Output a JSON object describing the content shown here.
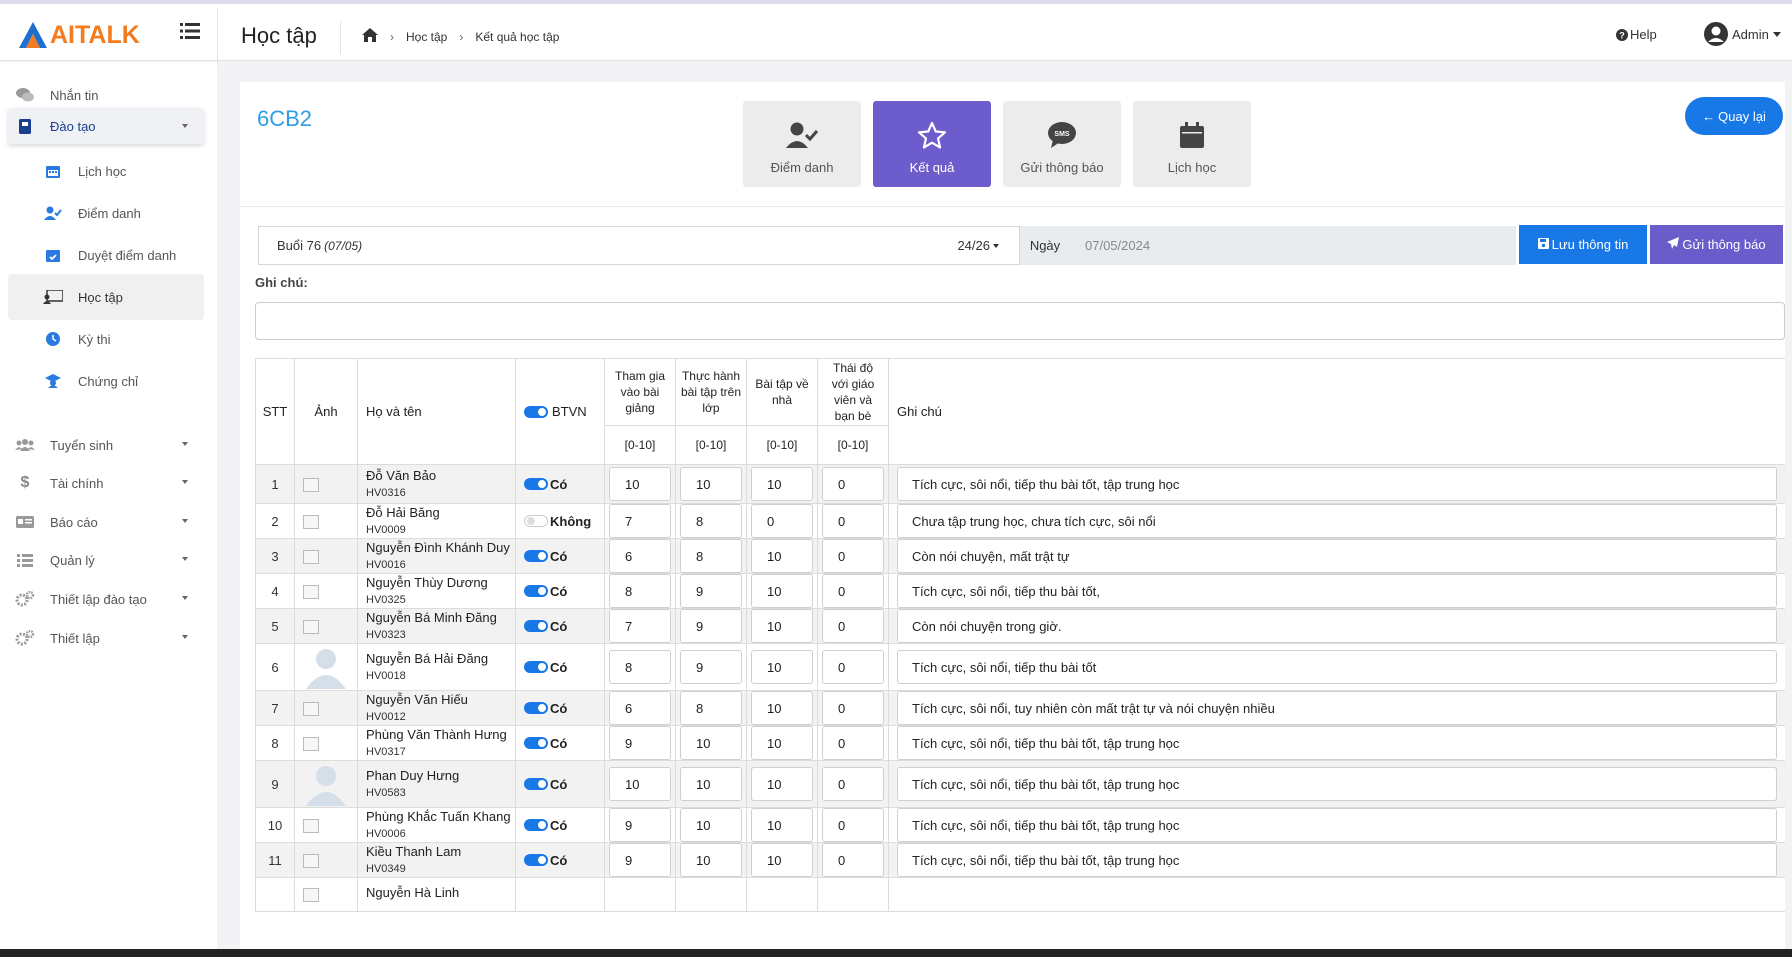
{
  "app": {
    "name": "AITALK"
  },
  "header": {
    "page_title": "Học tập",
    "breadcrumb": [
      "Học tập",
      "Kết quả học tập"
    ],
    "help": "Help",
    "user": "Admin"
  },
  "sidebar": {
    "items": [
      {
        "label": "Nhắn tin",
        "icon": "comments-icon"
      },
      {
        "label": "Đào tạo",
        "icon": "book-icon"
      },
      {
        "label": "Lịch học",
        "icon": "calendar-icon"
      },
      {
        "label": "Điểm danh",
        "icon": "user-check-icon"
      },
      {
        "label": "Duyệt điểm danh",
        "icon": "calendar-check-icon"
      },
      {
        "label": "Học tập",
        "icon": "chalkboard-teacher-icon"
      },
      {
        "label": "Kỳ thi",
        "icon": "clock-icon"
      },
      {
        "label": "Chứng chỉ",
        "icon": "graduation-cap-icon"
      },
      {
        "label": "Tuyển sinh",
        "icon": "users-icon"
      },
      {
        "label": "Tài chính",
        "icon": "dollar-icon"
      },
      {
        "label": "Báo cáo",
        "icon": "report-icon"
      },
      {
        "label": "Quản lý",
        "icon": "list-icon"
      },
      {
        "label": "Thiết lập đào tạo",
        "icon": "cogs-icon"
      },
      {
        "label": "Thiết lập",
        "icon": "cogs-icon"
      }
    ]
  },
  "main": {
    "class_code": "6CB2",
    "tabs": [
      {
        "label": "Điểm danh",
        "icon": "user-check-icon"
      },
      {
        "label": "Kết quả",
        "icon": "star-icon"
      },
      {
        "label": "Gửi thông báo",
        "icon": "sms-icon"
      },
      {
        "label": "Lịch học",
        "icon": "calendar-icon"
      }
    ],
    "back_label": "Quay lại",
    "session": {
      "label": "Buổi 76",
      "date": "(07/05)",
      "count": "24/26"
    },
    "date_label": "Ngày",
    "date_value": "07/05/2024",
    "save_label": "Lưu thông tin",
    "send_label": "Gửi thông báo",
    "note_label": "Ghi chú:",
    "note_value": ""
  },
  "table": {
    "headers": {
      "stt": "STT",
      "photo": "Ảnh",
      "name": "Họ và tên",
      "btvn": "BTVN",
      "c1": "Tham gia vào bài giảng",
      "c2": "Thực hành bài tập trên lớp",
      "c3": "Bài tập về nhà",
      "c4": "Thái độ với giáo viên và bạn bè",
      "range": "[0-10]",
      "note": "Ghi chú"
    },
    "rows": [
      {
        "stt": "1",
        "name": "Đỗ Văn Bảo",
        "code": "HV0316",
        "photo": "broken",
        "btvn": true,
        "btvn_label": "Có",
        "s1": "10",
        "s2": "10",
        "s3": "10",
        "s4": "0",
        "note": "Tích cực, sôi nổi, tiếp thu bài tốt, tập trung học"
      },
      {
        "stt": "2",
        "name": "Đỗ Hải Băng",
        "code": "HV0009",
        "photo": "broken",
        "btvn": false,
        "btvn_label": "Không",
        "s1": "7",
        "s2": "8",
        "s3": "0",
        "s4": "0",
        "note": "Chưa tập trung học, chưa tích cực, sôi nổi"
      },
      {
        "stt": "3",
        "name": "Nguyễn Đình Khánh Duy",
        "code": "HV0016",
        "photo": "broken",
        "btvn": true,
        "btvn_label": "Có",
        "s1": "6",
        "s2": "8",
        "s3": "10",
        "s4": "0",
        "note": "Còn nói chuyện, mất trật tự"
      },
      {
        "stt": "4",
        "name": "Nguyễn Thùy Dương",
        "code": "HV0325",
        "photo": "broken",
        "btvn": true,
        "btvn_label": "Có",
        "s1": "8",
        "s2": "9",
        "s3": "10",
        "s4": "0",
        "note": "Tích cực, sôi nổi, tiếp thu bài tốt,"
      },
      {
        "stt": "5",
        "name": "Nguyễn Bá Minh Đăng",
        "code": "HV0323",
        "photo": "broken",
        "btvn": true,
        "btvn_label": "Có",
        "s1": "7",
        "s2": "9",
        "s3": "10",
        "s4": "0",
        "note": "Còn nói chuyện trong giờ."
      },
      {
        "stt": "6",
        "name": "Nguyễn Bá Hải Đăng",
        "code": "HV0018",
        "photo": "avatar",
        "btvn": true,
        "btvn_label": "Có",
        "s1": "8",
        "s2": "9",
        "s3": "10",
        "s4": "0",
        "note": "Tích cực, sôi nổi, tiếp thu bài tốt"
      },
      {
        "stt": "7",
        "name": "Nguyễn Văn Hiếu",
        "code": "HV0012",
        "photo": "broken",
        "btvn": true,
        "btvn_label": "Có",
        "s1": "6",
        "s2": "8",
        "s3": "10",
        "s4": "0",
        "note": "Tích cực, sôi nổi, tuy nhiên còn mất trật tự và nói chuyện nhiều"
      },
      {
        "stt": "8",
        "name": "Phùng Văn Thành Hưng",
        "code": "HV0317",
        "photo": "broken",
        "btvn": true,
        "btvn_label": "Có",
        "s1": "9",
        "s2": "10",
        "s3": "10",
        "s4": "0",
        "note": "Tích cực, sôi nổi, tiếp thu bài tốt, tập trung học"
      },
      {
        "stt": "9",
        "name": "Phan Duy Hưng",
        "code": "HV0583",
        "photo": "avatar",
        "btvn": true,
        "btvn_label": "Có",
        "s1": "10",
        "s2": "10",
        "s3": "10",
        "s4": "0",
        "note": "Tích cực, sôi nổi, tiếp thu bài tốt, tập trung học"
      },
      {
        "stt": "10",
        "name": "Phùng Khắc Tuấn Khang",
        "code": "HV0006",
        "photo": "broken",
        "btvn": true,
        "btvn_label": "Có",
        "s1": "9",
        "s2": "10",
        "s3": "10",
        "s4": "0",
        "note": "Tích cực, sôi nổi, tiếp thu bài tốt, tập trung học"
      },
      {
        "stt": "11",
        "name": "Kiều Thanh Lam",
        "code": "HV0349",
        "photo": "broken",
        "btvn": true,
        "btvn_label": "Có",
        "s1": "9",
        "s2": "10",
        "s3": "10",
        "s4": "0",
        "note": "Tích cực, sôi nổi, tiếp thu bài tốt, tập trung học"
      },
      {
        "stt": "",
        "name": "Nguyễn Hà Linh",
        "code": "",
        "photo": "broken",
        "btvn": true,
        "btvn_label": "",
        "s1": "",
        "s2": "",
        "s3": "",
        "s4": "",
        "note": ""
      }
    ]
  },
  "colors": {
    "accent": "#1778e6",
    "purple": "#6c5ccc",
    "logo_orange": "#f47c20",
    "title_blue": "#2e9de8"
  }
}
